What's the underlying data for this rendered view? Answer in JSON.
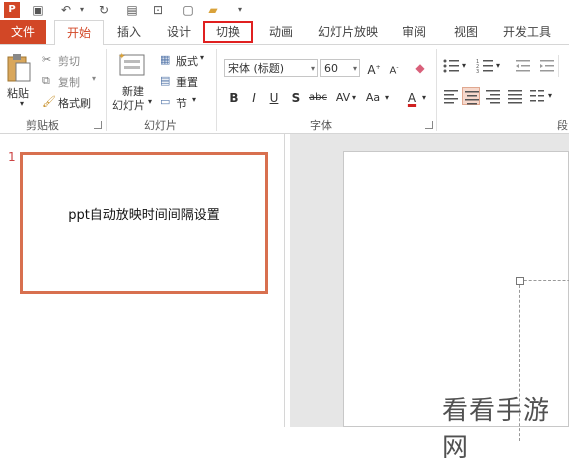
{
  "tabs": [
    "文件",
    "开始",
    "插入",
    "设计",
    "切换",
    "动画",
    "幻灯片放映",
    "审阅",
    "视图",
    "开发工具"
  ],
  "clipboard": {
    "paste": "粘贴",
    "cut": "剪切",
    "copy": "复制",
    "format_painter": "格式刷",
    "group_label": "剪贴板"
  },
  "slides_group": {
    "new_slide_line1": "新建",
    "new_slide_line2": "幻灯片",
    "layout": "版式",
    "reset": "重置",
    "section": "节",
    "group_label": "幻灯片"
  },
  "font_group": {
    "font_name": "宋体 (标题)",
    "font_size": "60",
    "group_label": "字体",
    "bold": "B",
    "italic": "I",
    "underline": "U",
    "shadow": "S",
    "strike": "abc",
    "spacing": "AV",
    "case": "Aa"
  },
  "paragraph_group": {
    "group_label_partial": "段"
  },
  "slide_pane": {
    "slide_number": "1",
    "thumb_text": "ppt自动放映时间间隔设置"
  },
  "watermark": "看看手游网",
  "colors": {
    "accent": "#d24726",
    "highlight_box": "#e02020",
    "thumb_border": "#d8704f"
  }
}
